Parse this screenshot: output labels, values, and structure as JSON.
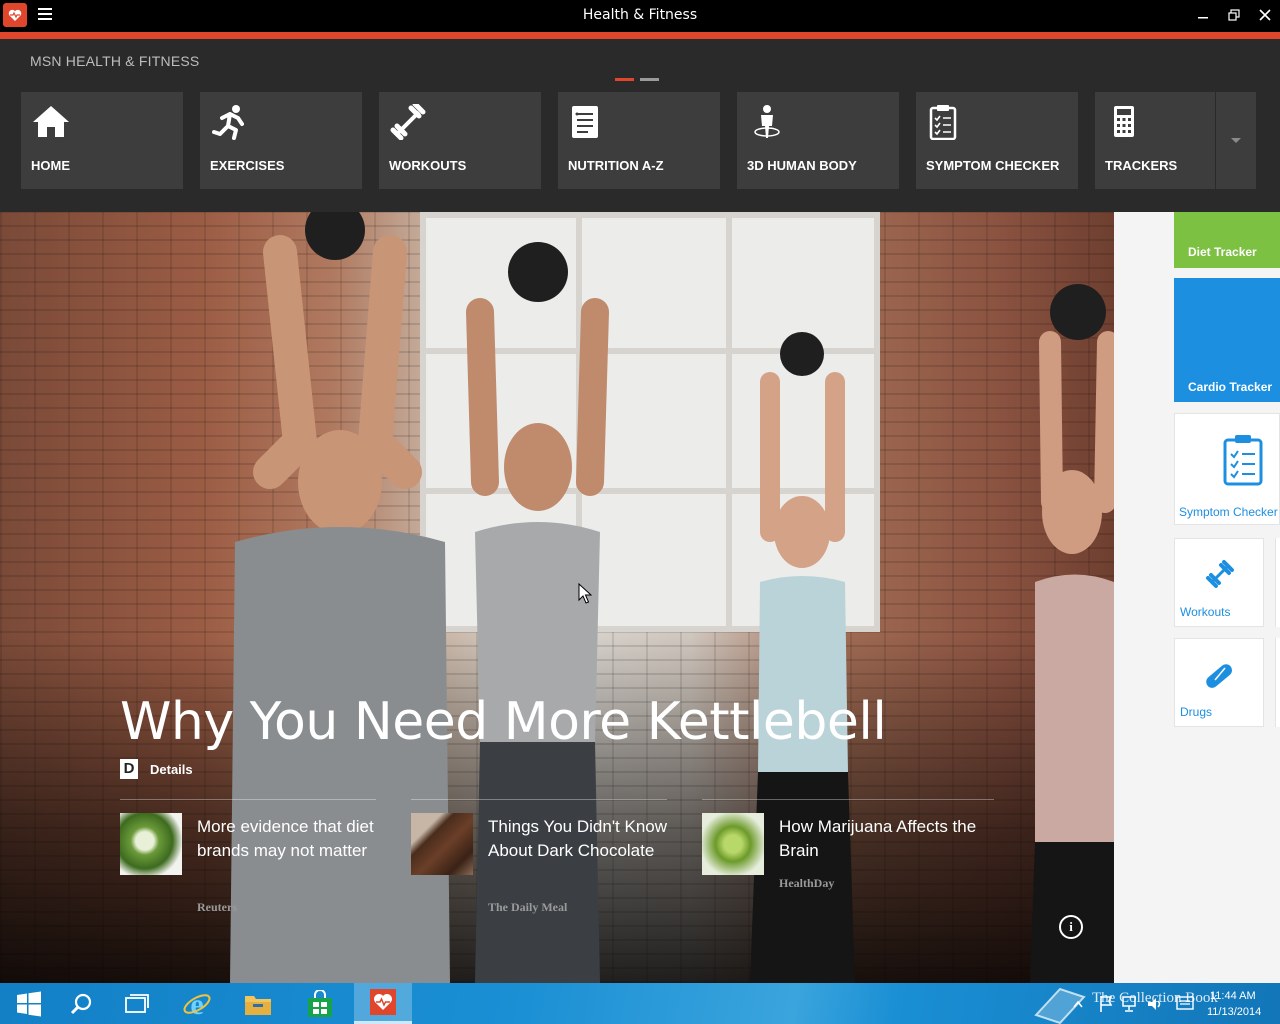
{
  "window": {
    "title": "Health & Fitness",
    "accent_color": "#e0462c"
  },
  "header": {
    "brand": "MSN HEALTH & FITNESS",
    "pager": {
      "pages": 2,
      "active": 1
    }
  },
  "nav": {
    "tiles": [
      {
        "label": "HOME",
        "icon": "home-icon"
      },
      {
        "label": "EXERCISES",
        "icon": "running-icon"
      },
      {
        "label": "WORKOUTS",
        "icon": "dumbbell-icon"
      },
      {
        "label": "NUTRITION A-Z",
        "icon": "notepad-icon"
      },
      {
        "label": "3D HUMAN BODY",
        "icon": "human-body-icon"
      },
      {
        "label": "SYMPTOM CHECKER",
        "icon": "clipboard-icon"
      },
      {
        "label": "TRACKERS",
        "icon": "calculator-icon"
      }
    ]
  },
  "hero": {
    "title": "Why You Need More Kettlebell",
    "details_badge": "D",
    "details_label": "Details",
    "stories": [
      {
        "headline": "More evidence that diet brands may not matter",
        "source": "Reuters"
      },
      {
        "headline": "Things You Didn't Know About Dark Chocolate",
        "source": "The Daily Meal"
      },
      {
        "headline": "How Marijuana Affects the Brain",
        "source": "HealthDay"
      }
    ],
    "info_label": "i"
  },
  "right_panel": {
    "tiles": [
      {
        "label": "Diet Tracker",
        "color": "#7cc142"
      },
      {
        "label": "Cardio Tracker",
        "color": "#1d8fe0"
      },
      {
        "label": "Symptom Checker",
        "color": "#1d8fe0"
      },
      {
        "label": "Workouts",
        "color": "#1d8fe0"
      },
      {
        "label": "Drugs",
        "color": "#1d8fe0"
      }
    ]
  },
  "taskbar": {
    "apps": [
      "start-icon",
      "search-icon",
      "task-view-icon",
      "internet-explorer-icon",
      "file-explorer-icon",
      "store-icon",
      "health-fitness-icon"
    ],
    "watermark": "The Collection Book",
    "time": "11:44 AM",
    "date": "11/13/2014"
  }
}
